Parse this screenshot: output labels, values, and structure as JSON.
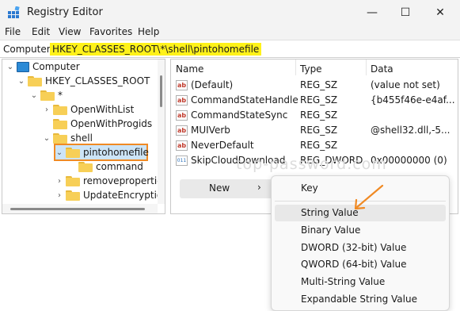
{
  "window": {
    "title": "Registry Editor",
    "minimize": "—",
    "maximize": "☐",
    "close": "✕"
  },
  "menu": [
    "File",
    "Edit",
    "View",
    "Favorites",
    "Help"
  ],
  "address": {
    "prefix": "Computer\\",
    "path": "HKEY_CLASSES_ROOT\\*\\shell\\pintohomefile"
  },
  "tree": [
    {
      "label": "Computer",
      "chevron": "⌄",
      "icon": "computer-icon"
    },
    {
      "label": "HKEY_CLASSES_ROOT",
      "chevron": "⌄",
      "icon": "folder-icon"
    },
    {
      "label": "*",
      "chevron": "⌄",
      "icon": "folder-icon"
    },
    {
      "label": "OpenWithList",
      "chevron": "›",
      "icon": "folder-icon"
    },
    {
      "label": "OpenWithProgids",
      "chevron": "",
      "icon": "folder-icon"
    },
    {
      "label": "shell",
      "chevron": "⌄",
      "icon": "folder-icon"
    },
    {
      "label": "pintohomefile",
      "chevron": "⌄",
      "icon": "folder-icon"
    },
    {
      "label": "command",
      "chevron": "",
      "icon": "folder-icon"
    },
    {
      "label": "removeproperties",
      "chevron": "›",
      "icon": "folder-icon"
    },
    {
      "label": "UpdateEncryption",
      "chevron": "›",
      "icon": "folder-icon"
    }
  ],
  "columns": {
    "name": "Name",
    "type": "Type",
    "data": "Data"
  },
  "values": [
    {
      "name": "(Default)",
      "type": "REG_SZ",
      "data": "(value not set)",
      "icon": "string-value-icon"
    },
    {
      "name": "CommandStateHandler",
      "type": "REG_SZ",
      "data": "{b455f46e-e4af...",
      "icon": "string-value-icon"
    },
    {
      "name": "CommandStateSync",
      "type": "REG_SZ",
      "data": "",
      "icon": "string-value-icon"
    },
    {
      "name": "MUIVerb",
      "type": "REG_SZ",
      "data": "@shell32.dll,-5...",
      "icon": "string-value-icon"
    },
    {
      "name": "NeverDefault",
      "type": "REG_SZ",
      "data": "",
      "icon": "string-value-icon"
    },
    {
      "name": "SkipCloudDownload",
      "type": "REG_DWORD",
      "data": "0x00000000 (0)",
      "icon": "binary-value-icon"
    }
  ],
  "context_menu": {
    "new_label": "New",
    "arrow": "›"
  },
  "submenu": [
    "Key",
    "String Value",
    "Binary Value",
    "DWORD (32-bit) Value",
    "QWORD (64-bit) Value",
    "Multi-String Value",
    "Expandable String Value"
  ],
  "watermark": "top-password.com",
  "colors": {
    "highlight": "#fff21a",
    "annotation": "#f08a24",
    "selection": "#cce4f7"
  }
}
